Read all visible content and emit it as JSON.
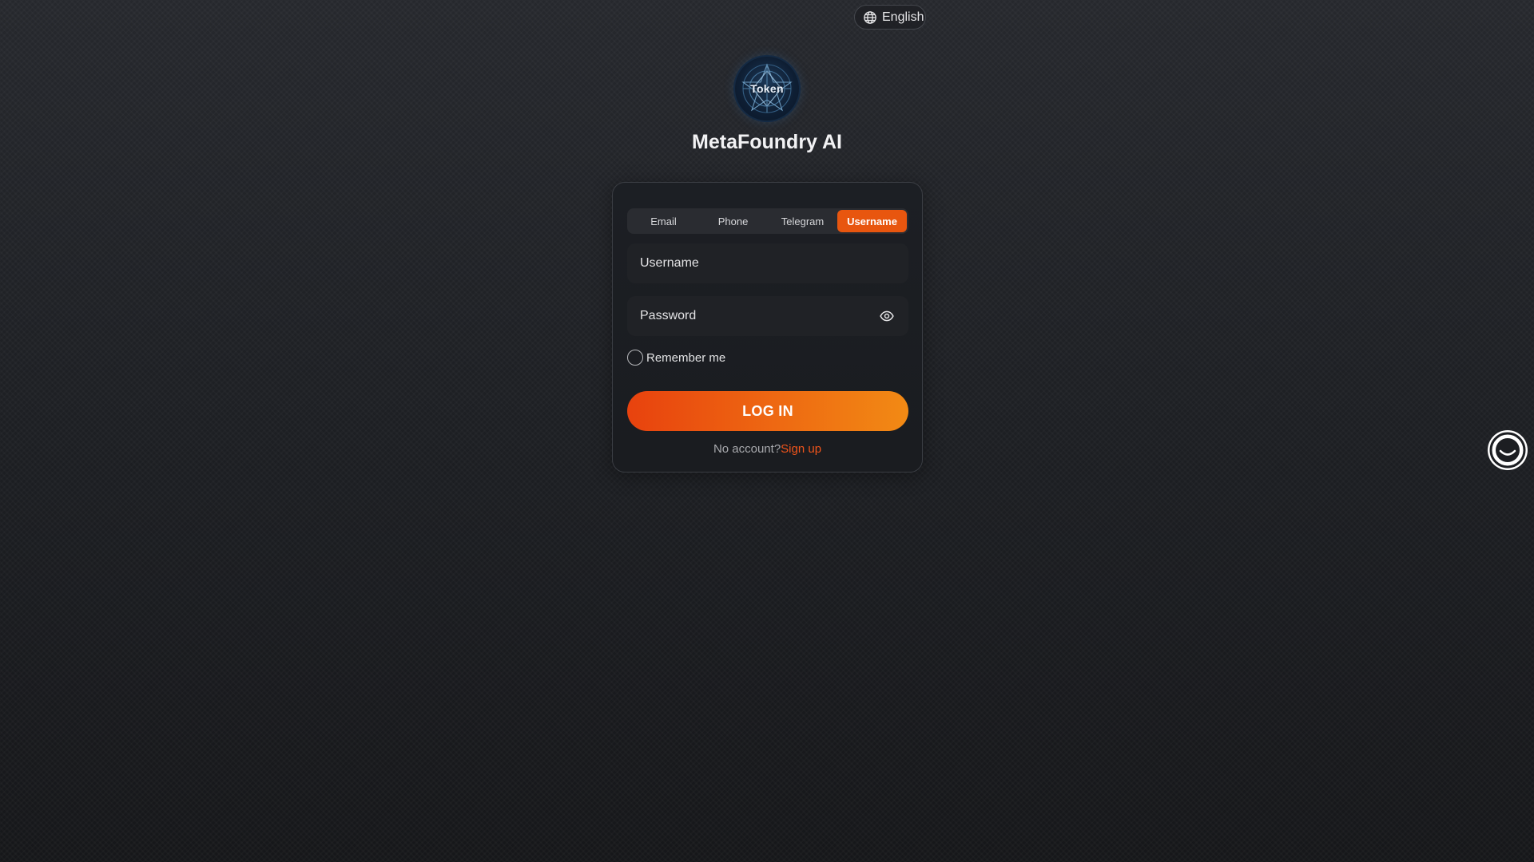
{
  "language": {
    "label": "English",
    "icon": "globe-icon"
  },
  "logo": {
    "text": "Token"
  },
  "brand": {
    "name": "MetaFoundry AI"
  },
  "tabs": [
    {
      "label": "Email",
      "active": false
    },
    {
      "label": "Phone",
      "active": false
    },
    {
      "label": "Telegram",
      "active": false
    },
    {
      "label": "Username",
      "active": true
    }
  ],
  "form": {
    "username_placeholder": "Username",
    "password_placeholder": "Password",
    "remember_label": "Remember me",
    "login_label": "LOG IN",
    "no_account_text": "No account?",
    "signup_label": "Sign up"
  },
  "colors": {
    "accent": "#e8560f",
    "link": "#f0541b",
    "background": "#1d1f23"
  },
  "support": {
    "icon": "support-chat-icon"
  }
}
